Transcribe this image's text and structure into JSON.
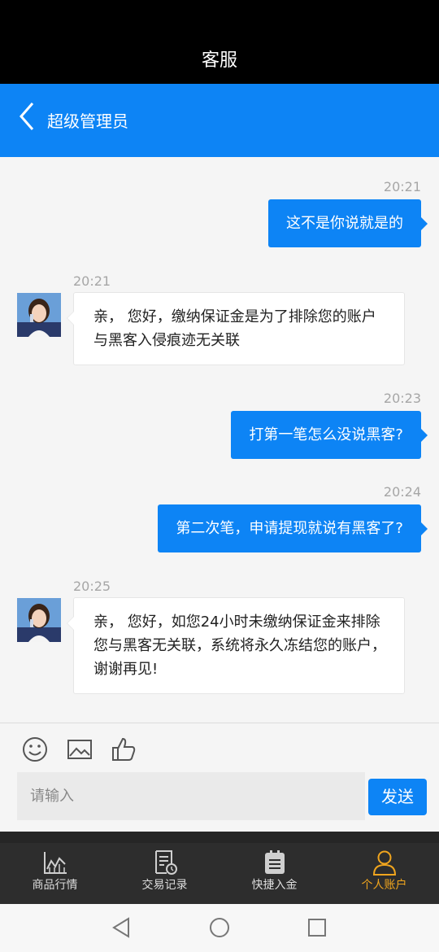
{
  "status": {
    "title": "客服"
  },
  "nav": {
    "title": "超级管理员",
    "back_icon": "chevron-left-icon"
  },
  "messages": [
    {
      "direction": "out",
      "time": "20:21",
      "text": "这不是你说就是的"
    },
    {
      "direction": "in",
      "time": "20:21",
      "text": "亲， 您好，缴纳保证金是为了排除您的账户与黑客入侵痕迹无关联"
    },
    {
      "direction": "out",
      "time": "20:23",
      "text": "打第一笔怎么没说黑客?"
    },
    {
      "direction": "out",
      "time": "20:24",
      "text": "第二次笔，申请提现就说有黑客了?"
    },
    {
      "direction": "in",
      "time": "20:25",
      "text": "亲， 您好，如您24小时未缴纳保证金来排除您与黑客无关联，系统将永久冻结您的账户，谢谢再见!"
    }
  ],
  "composer": {
    "placeholder": "请输入",
    "send_label": "发送",
    "icons": [
      "smile-icon",
      "image-icon",
      "thumbs-up-icon"
    ]
  },
  "tabs": [
    {
      "label": "商品行情",
      "icon": "chart-icon",
      "active": false
    },
    {
      "label": "交易记录",
      "icon": "record-icon",
      "active": false
    },
    {
      "label": "快捷入金",
      "icon": "clipboard-icon",
      "active": false
    },
    {
      "label": "个人账户",
      "icon": "user-icon",
      "active": true
    }
  ],
  "colors": {
    "primary": "#0d84f5",
    "tab_active": "#f0a51e",
    "tabbar_bg": "#2d2d2d"
  }
}
